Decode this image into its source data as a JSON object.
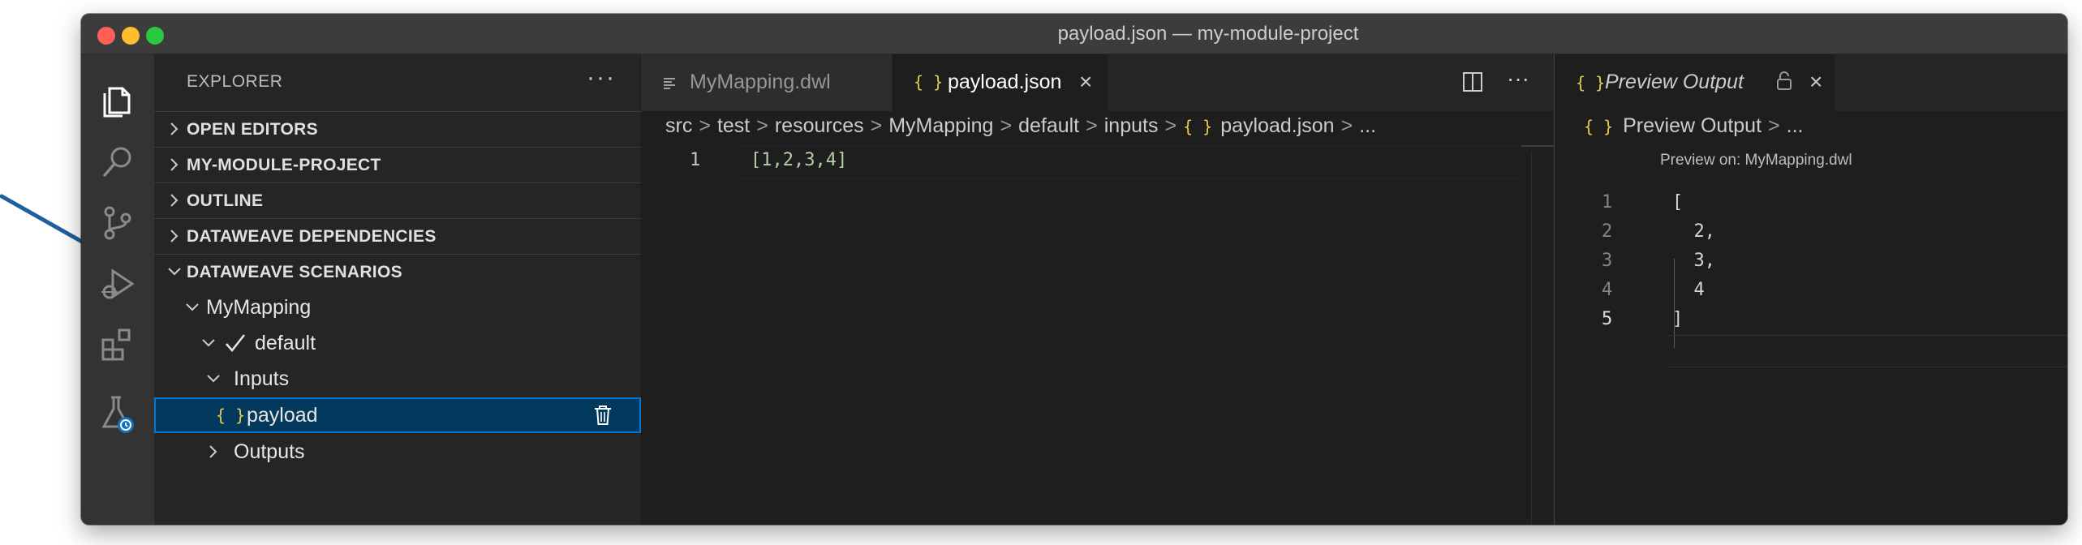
{
  "window": {
    "title": "payload.json — my-module-project"
  },
  "sidebar": {
    "title": "EXPLORER",
    "more": "···",
    "sections": [
      {
        "label": "OPEN EDITORS",
        "expanded": false
      },
      {
        "label": "MY-MODULE-PROJECT",
        "expanded": false
      },
      {
        "label": "OUTLINE",
        "expanded": false
      },
      {
        "label": "DATAWEAVE DEPENDENCIES",
        "expanded": false
      },
      {
        "label": "DATAWEAVE SCENARIOS",
        "expanded": true
      }
    ],
    "tree": [
      {
        "label": "MyMapping",
        "expanded": true
      },
      {
        "label": "default",
        "expanded": true,
        "checked": true
      },
      {
        "label": "Inputs",
        "expanded": true
      },
      {
        "label": "payload",
        "selected": true,
        "icon": "json-braces-icon"
      },
      {
        "label": "Outputs",
        "expanded": false
      }
    ]
  },
  "editor": {
    "tabs": [
      {
        "label": "MyMapping.dwl",
        "active": false,
        "icon": "lines-icon"
      },
      {
        "label": "payload.json",
        "active": true,
        "icon": "json-braces-icon",
        "close": "×"
      }
    ],
    "breadcrumb": [
      "src",
      "test",
      "resources",
      "MyMapping",
      "default",
      "inputs",
      "payload.json",
      "..."
    ],
    "lines": [
      {
        "n": "1",
        "text": "[1,2,3,4]"
      }
    ]
  },
  "preview": {
    "tab_label": "Preview Output",
    "tab_close": "×",
    "breadcrumb": [
      "Preview Output",
      "..."
    ],
    "preview_on": "Preview on: MyMapping.dwl",
    "lines": [
      {
        "n": "1",
        "text": "["
      },
      {
        "n": "2",
        "text": "  2,"
      },
      {
        "n": "3",
        "text": "  3,"
      },
      {
        "n": "4",
        "text": "  4"
      },
      {
        "n": "5",
        "text": "]"
      }
    ]
  },
  "glyphs": {
    "json_braces": "{ }",
    "breadcrumb_sep": ">"
  },
  "colors": {
    "accent": "#0078d4",
    "selection": "#04395e",
    "json_icon": "#e8c94a",
    "arrow": "#1f5f9c"
  }
}
